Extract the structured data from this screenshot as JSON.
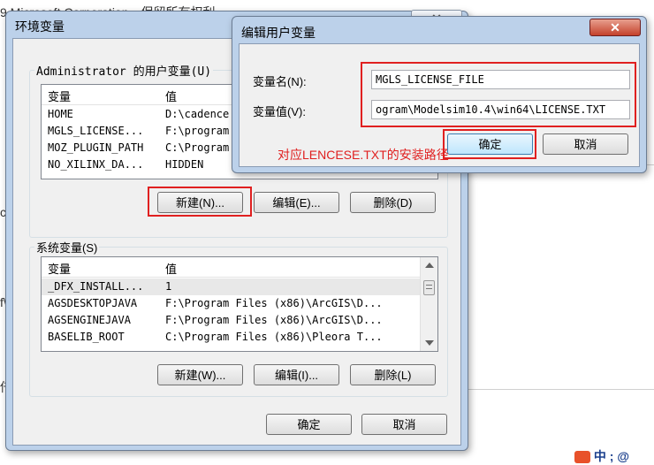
{
  "background": {
    "top_text": "9 Microsoft Corporation。保留所有权利",
    "left_text_1": "c",
    "left_text_2": "f\\",
    "left_text_3": "仟",
    "bottom_right_text": "中 ; @"
  },
  "env_dialog": {
    "title": "环境变量",
    "user_group_label": "Administrator 的用户变量(U)",
    "column_name": "变量",
    "column_value": "值",
    "user_vars": [
      {
        "name": "HOME",
        "value": "D:\\cadence"
      },
      {
        "name": "MGLS_LICENSE...",
        "value": "F:\\program"
      },
      {
        "name": "MOZ_PLUGIN_PATH",
        "value": "C:\\Program"
      },
      {
        "name": "NO_XILINX_DA...",
        "value": "HIDDEN"
      }
    ],
    "user_buttons": {
      "new": "新建(N)...",
      "edit": "编辑(E)...",
      "delete": "删除(D)"
    },
    "system_group_label": "系统变量(S)",
    "system_vars": [
      {
        "name": "_DFX_INSTALL...",
        "value": "1"
      },
      {
        "name": "AGSDESKTOPJAVA",
        "value": "F:\\Program Files (x86)\\ArcGIS\\D..."
      },
      {
        "name": "AGSENGINEJAVA",
        "value": "F:\\Program Files (x86)\\ArcGIS\\D..."
      },
      {
        "name": "BASELIB_ROOT",
        "value": "C:\\Program Files (x86)\\Pleora T..."
      }
    ],
    "system_buttons": {
      "new": "新建(W)...",
      "edit": "编辑(I)...",
      "delete": "删除(L)"
    },
    "ok": "确定",
    "cancel": "取消",
    "close_glyph": "✕"
  },
  "edit_dialog": {
    "title": "编辑用户变量",
    "close_glyph": "✕",
    "name_label": "变量名(N):",
    "name_value": "MGLS_LICENSE_FILE",
    "value_label": "变量值(V):",
    "value_value": "ogram\\Modelsim10.4\\win64\\LICENSE.TXT",
    "ok": "确定",
    "cancel": "取消",
    "annotation": "对应LENCESE.TXT的安装路径"
  },
  "colors": {
    "annotation_red": "#e02020",
    "title_bar": "#bcd1ea"
  }
}
